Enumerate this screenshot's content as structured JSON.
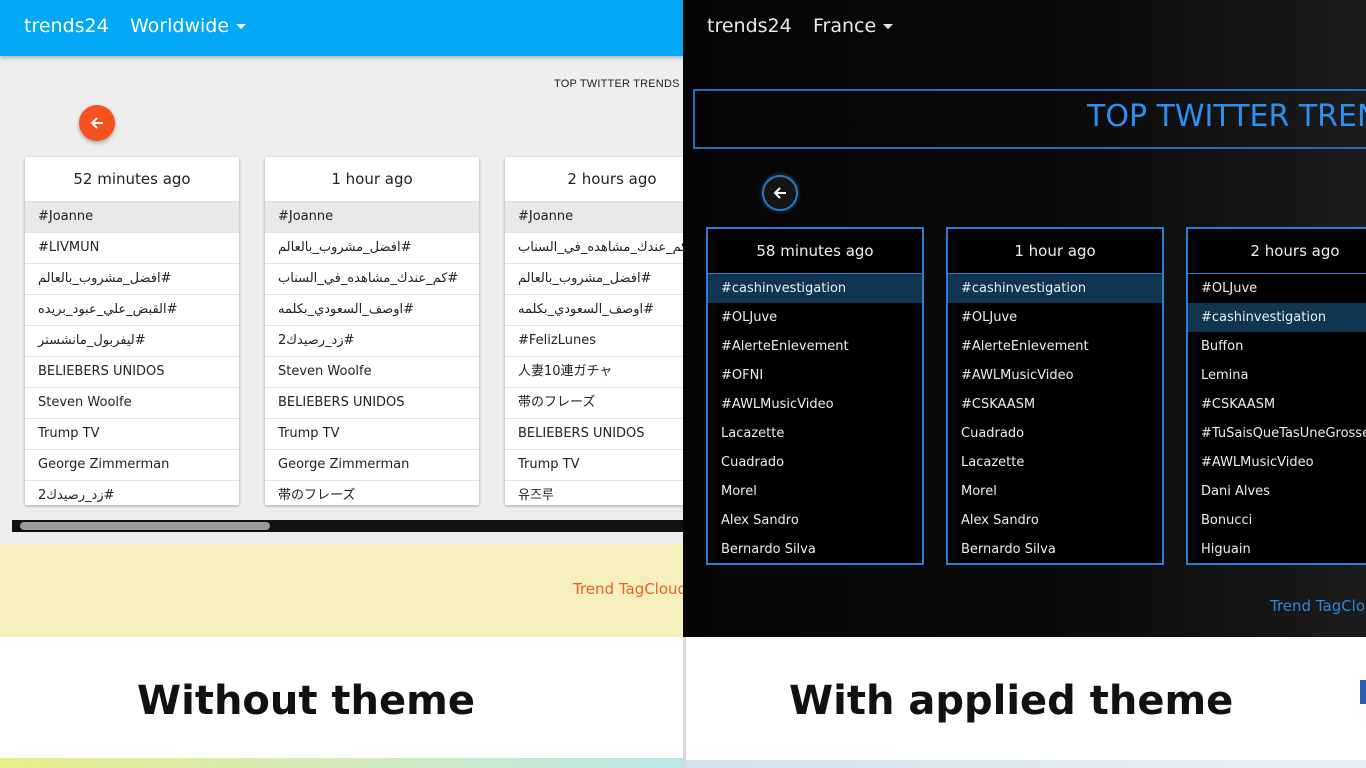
{
  "left": {
    "brand": "trends24",
    "region": "Worldwide",
    "page_title": "TOP TWITTER TRENDS FO",
    "cards": [
      {
        "time": "52 minutes ago",
        "trends": [
          "#Joanne",
          "#LIVMUN",
          "#افضل_مشروب_بالعالم",
          "#القبض_علي_عبود_بريده",
          "#ليفربول_مانشستر",
          "BELIEBERS UNIDOS",
          "Steven Woolfe",
          "Trump TV",
          "George Zimmerman",
          "#زد_رصيدك2"
        ]
      },
      {
        "time": "1 hour ago",
        "trends": [
          "#Joanne",
          "#افضل_مشروب_بالعالم",
          "#كم_عندك_مشاهده_في_السناب",
          "#اوصف_السعودي_بكلمه",
          "#زد_رصيدك2",
          "Steven Woolfe",
          "BELIEBERS UNIDOS",
          "Trump TV",
          "George Zimmerman",
          "帯のフレーズ"
        ]
      },
      {
        "time": "2 hours ago",
        "trends": [
          "#Joanne",
          "#كم_عندك_مشاهده_في_السناب",
          "#افضل_مشروب_بالعالم",
          "#اوصف_السعودي_بكلمه",
          "#FelizLunes",
          "人妻10連ガチャ",
          "帯のフレーズ",
          "BELIEBERS UNIDOS",
          "Trump TV",
          "유즈루"
        ]
      }
    ],
    "tagcloud_link": "Trend TagCloud",
    "caption": "Without theme"
  },
  "right": {
    "brand": "trends24",
    "region": "France",
    "page_title": "TOP TWITTER TRENDS",
    "cards": [
      {
        "time": "58 minutes ago",
        "highlight": 0,
        "trends": [
          "#cashinvestigation",
          "#OLJuve",
          "#AlerteEnlevement",
          "#OFNI",
          "#AWLMusicVideo",
          "Lacazette",
          "Cuadrado",
          "Morel",
          "Alex Sandro",
          "Bernardo Silva"
        ]
      },
      {
        "time": "1 hour ago",
        "highlight": 0,
        "trends": [
          "#cashinvestigation",
          "#OLJuve",
          "#AlerteEnlevement",
          "#AWLMusicVideo",
          "#CSKAASM",
          "Cuadrado",
          "Lacazette",
          "Morel",
          "Alex Sandro",
          "Bernardo Silva"
        ]
      },
      {
        "time": "2 hours ago",
        "highlight": 1,
        "trends": [
          "#OLJuve",
          "#cashinvestigation",
          "Buffon",
          "Lemina",
          "#CSKAASM",
          "#TuSaisQueTasUneGrossePo",
          "#AWLMusicVideo",
          "Dani Alves",
          "Bonucci",
          "Higuain"
        ]
      }
    ],
    "tagcloud_link": "Trend TagClou",
    "caption": "With applied theme"
  },
  "icons": {
    "back": "arrow-left-icon",
    "dropdown": "caret-down-icon"
  },
  "colors": {
    "light_nav": "#03a9f4",
    "back_button": "#f4511e",
    "dark_accent": "#2b7fd0",
    "tagcloud_light": "#e8622a"
  }
}
